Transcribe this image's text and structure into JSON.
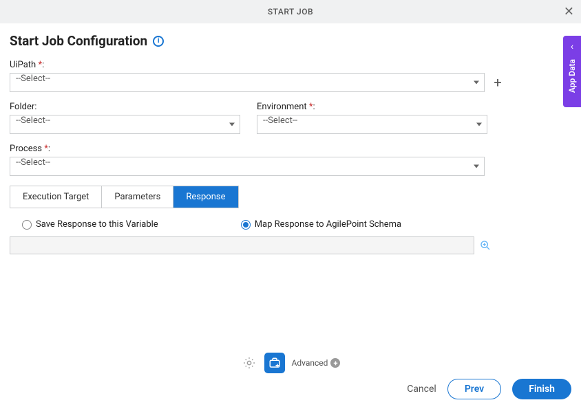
{
  "header": {
    "title": "START JOB"
  },
  "page": {
    "title": "Start Job Configuration"
  },
  "fields": {
    "uipath": {
      "label": "UiPath",
      "required": "*",
      "colon": ":",
      "value": "--Select--"
    },
    "folder": {
      "label": "Folder:",
      "value": "--Select--"
    },
    "environment": {
      "label": "Environment",
      "required": "*",
      "colon": ":",
      "value": "--Select--"
    },
    "process": {
      "label": "Process",
      "required": "*",
      "colon": ":",
      "value": "--Select--"
    }
  },
  "tabs": {
    "items": [
      {
        "label": "Execution Target"
      },
      {
        "label": "Parameters"
      },
      {
        "label": "Response"
      }
    ]
  },
  "response": {
    "option_save": "Save Response to this Variable",
    "option_map": "Map Response to AgilePoint Schema"
  },
  "sidetab": {
    "label": "App Data"
  },
  "footer": {
    "advanced": "Advanced",
    "cancel": "Cancel",
    "prev": "Prev",
    "finish": "Finish"
  }
}
